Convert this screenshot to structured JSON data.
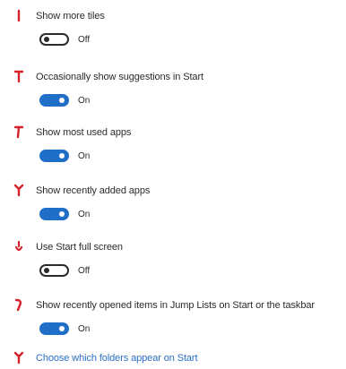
{
  "settings": [
    {
      "label": "Show more tiles",
      "state": "Off",
      "on": false
    },
    {
      "label": "Occasionally show suggestions in Start",
      "state": "On",
      "on": true
    },
    {
      "label": "Show most used apps",
      "state": "On",
      "on": true
    },
    {
      "label": "Show recently added apps",
      "state": "On",
      "on": true
    },
    {
      "label": "Use Start full screen",
      "state": "Off",
      "on": false
    },
    {
      "label": "Show recently opened items in Jump Lists on Start or the taskbar",
      "state": "On",
      "on": true
    }
  ],
  "link": {
    "label": "Choose which folders appear on Start"
  },
  "colors": {
    "accent": "#1f6fc8",
    "marker": "#d8202a",
    "text": "#2b2b2b",
    "link": "#2a6fc4"
  }
}
